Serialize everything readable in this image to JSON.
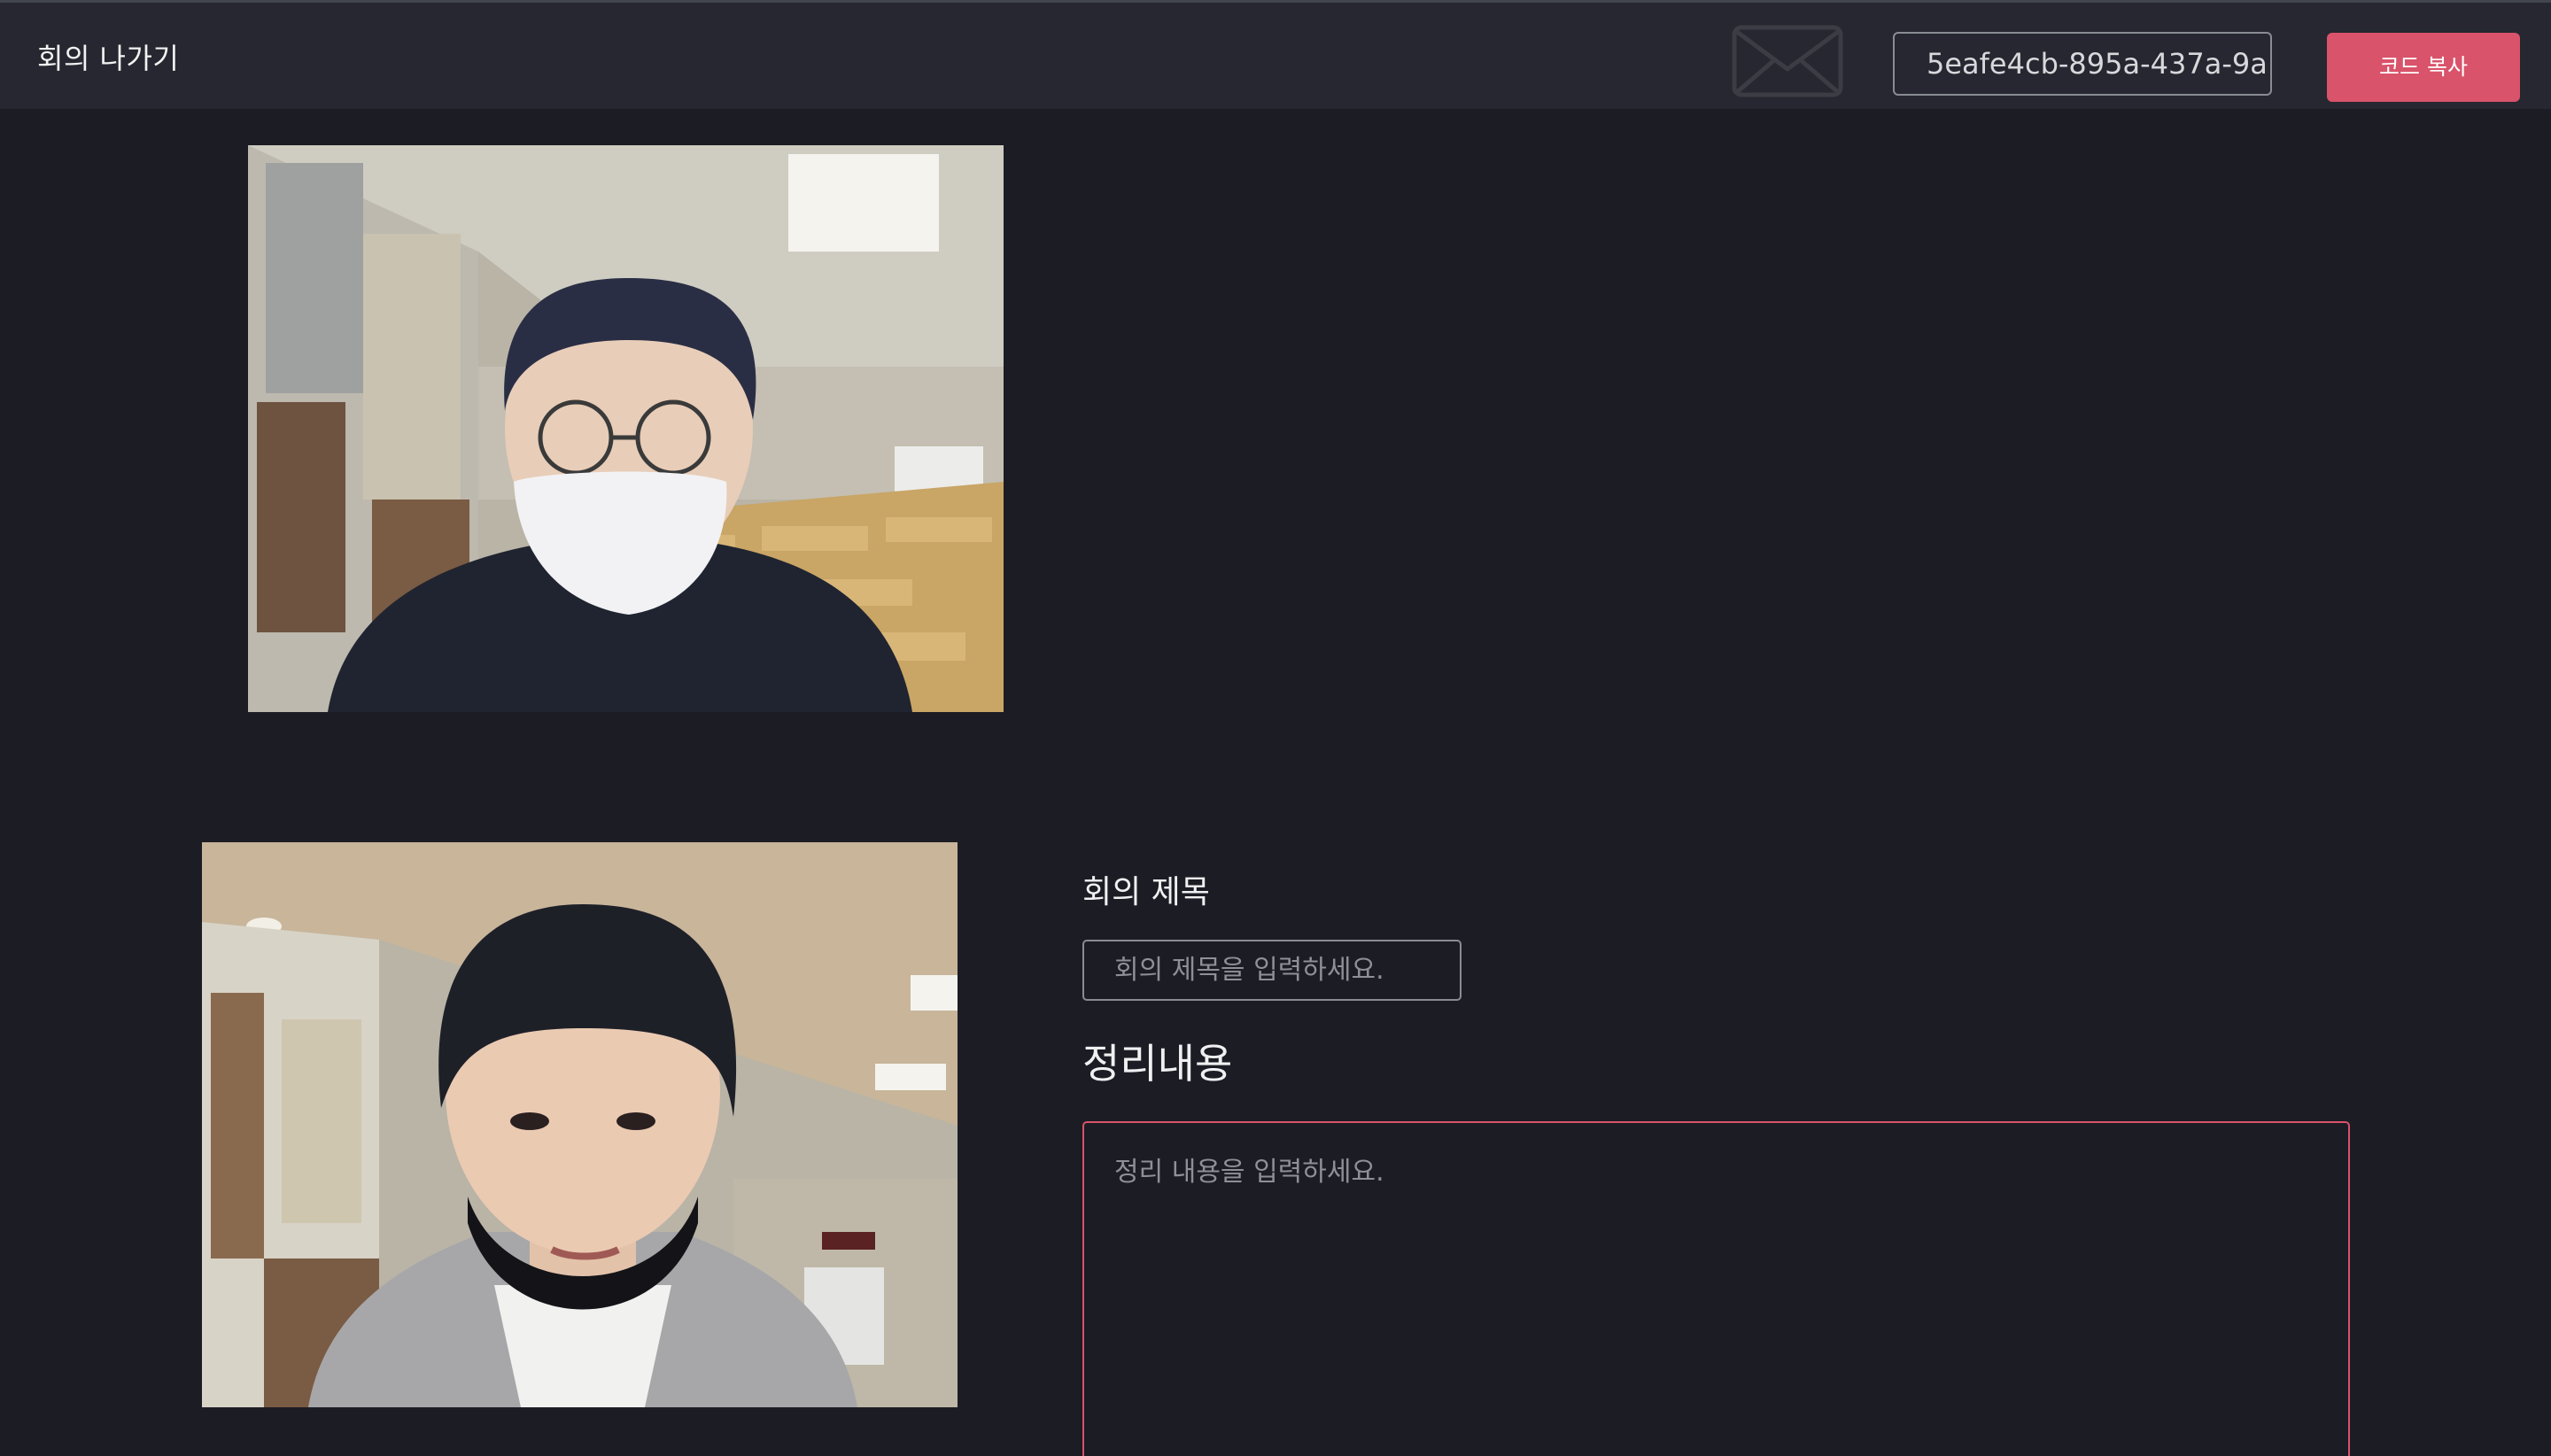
{
  "header": {
    "leave_label": "회의 나가기",
    "meeting_code": "5eafe4cb-895a-437a-9a",
    "copy_button_label": "코드 복사",
    "mail_icon": "envelope-icon"
  },
  "videos": [
    {
      "participant": "remote-participant"
    },
    {
      "participant": "local-participant"
    }
  ],
  "meeting_form": {
    "title_label": "회의 제목",
    "title_placeholder": "회의 제목을 입력하세요.",
    "title_value": "",
    "summary_heading": "정리내용",
    "summary_placeholder": "정리 내용을 입력하세요.",
    "summary_value": ""
  },
  "colors": {
    "background": "#1c1c24",
    "topbar": "#262730",
    "accent": "#d9536a",
    "input_border": "#8a8c94"
  }
}
